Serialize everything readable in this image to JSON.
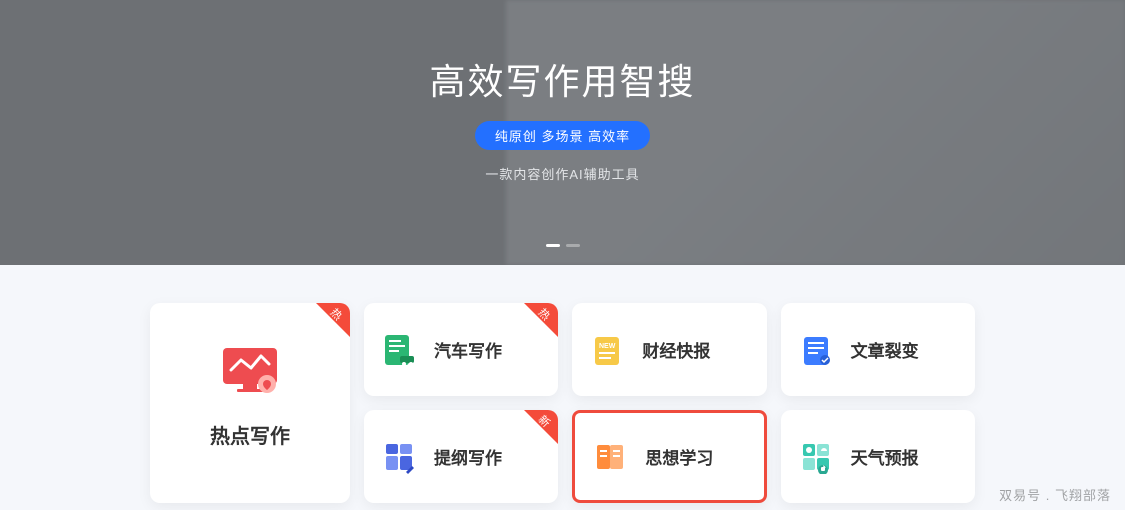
{
  "hero": {
    "title": "高效写作用智搜",
    "badge": "纯原创 多场景 高效率",
    "subtitle": "一款内容创作AI辅助工具"
  },
  "tags": {
    "hot": "热",
    "new": "新"
  },
  "cards": {
    "large": {
      "label": "热点写作",
      "icon": "monitor-chart-icon",
      "color": "#ee4c50"
    },
    "small": [
      {
        "label": "汽车写作",
        "icon": "doc-car-icon",
        "color": "#2bb673",
        "tag": "hot"
      },
      {
        "label": "财经快报",
        "icon": "doc-new-icon",
        "color": "#f7c948",
        "tag": null
      },
      {
        "label": "文章裂变",
        "icon": "doc-split-icon",
        "color": "#3c7cff",
        "tag": null
      },
      {
        "label": "提纲写作",
        "icon": "grid-edit-icon",
        "color": "#4a66e0",
        "tag": "new"
      },
      {
        "label": "思想学习",
        "icon": "book-icon",
        "color": "#ff8c3c",
        "tag": null,
        "highlighted": true
      },
      {
        "label": "天气预报",
        "icon": "weather-icon",
        "color": "#37c8b0",
        "tag": null
      }
    ]
  },
  "watermark": "双易号 . 飞翔部落"
}
